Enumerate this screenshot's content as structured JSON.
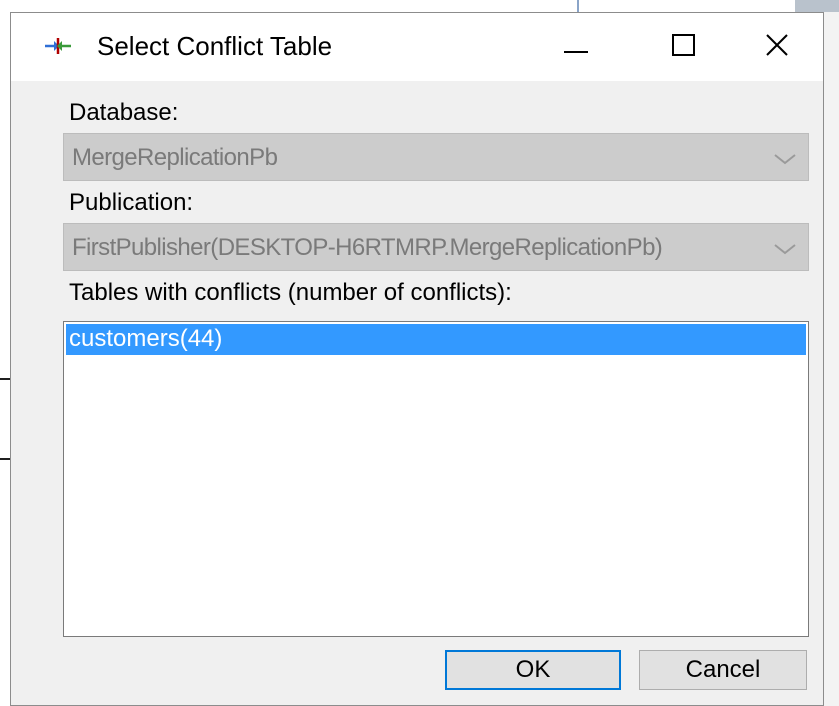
{
  "dialog": {
    "title": "Select Conflict Table",
    "icon": "merge-arrows-icon",
    "controls": {
      "minimize_icon": "minimize-icon",
      "maximize_icon": "maximize-icon",
      "close_icon": "close-icon"
    }
  },
  "database": {
    "label": "Database:",
    "value": "MergeReplicationPb"
  },
  "publication": {
    "label": "Publication:",
    "value": "FirstPublisher(DESKTOP-H6RTMRP.MergeReplicationPb)"
  },
  "tables": {
    "label": "Tables with conflicts (number of conflicts):",
    "items": [
      "customers(44)"
    ]
  },
  "buttons": {
    "ok": "OK",
    "cancel": "Cancel"
  },
  "colors": {
    "selection": "#3399ff",
    "default_button_border": "#0078d7",
    "disabled_field": "#cccccc"
  }
}
